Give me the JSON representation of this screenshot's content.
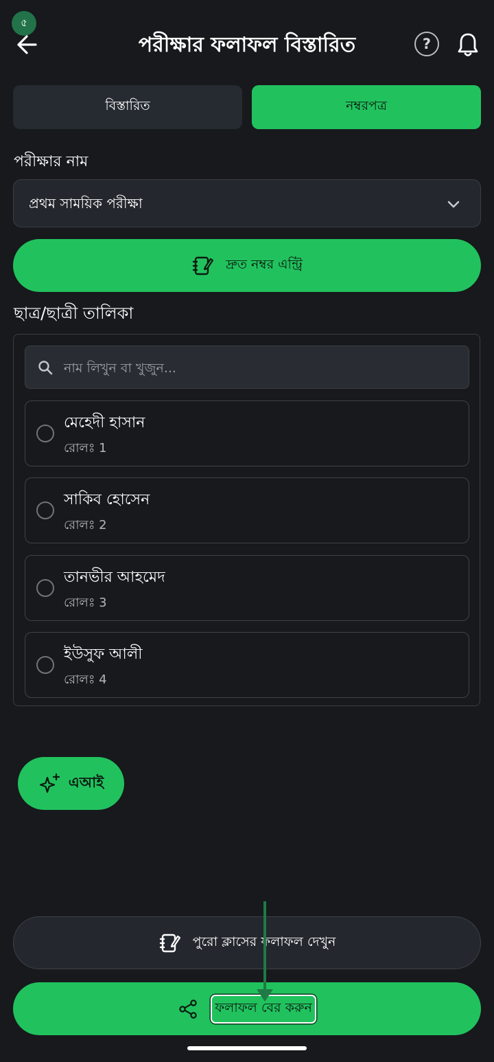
{
  "status": {
    "badge": "৫"
  },
  "header": {
    "title": "পরীক্ষার ফলাফল বিস্তারিত",
    "help_glyph": "?",
    "icons": [
      "back-arrow-icon",
      "help-icon",
      "bell-icon"
    ]
  },
  "tabs": [
    {
      "label": "বিস্তারিত",
      "selected": false
    },
    {
      "label": "নম্বরপত্র",
      "selected": true
    }
  ],
  "exam": {
    "label": "পরীক্ষার নাম",
    "selected": "প্রথম সাময়িক পরীক্ষা"
  },
  "quick_entry": {
    "label": "দ্রুত নম্বর এন্ট্রি"
  },
  "student_list": {
    "label": "ছাত্র/ছাত্রী তালিকা",
    "search_placeholder": "নাম লিখুন বা খুজুন...",
    "students": [
      {
        "name": "মেহেদী হাসান",
        "roll": "রোলঃ 1"
      },
      {
        "name": "সাকিব হোসেন",
        "roll": "রোলঃ 2"
      },
      {
        "name": "তানভীর আহমেদ",
        "roll": "রোলঃ 3"
      },
      {
        "name": "ইউসুফ আলী",
        "roll": "রোলঃ 4"
      }
    ]
  },
  "ai_button": {
    "label": "এআই"
  },
  "bottom": {
    "class_result_label": "পুরো ক্লাসের ফলাফল দেখুন",
    "result_label": "ফলাফল বের করুন"
  },
  "colors": {
    "background": "#17191c",
    "accent_green": "#21c25e",
    "surface": "#24272d",
    "arrow_overlay": "#1f7a45"
  }
}
